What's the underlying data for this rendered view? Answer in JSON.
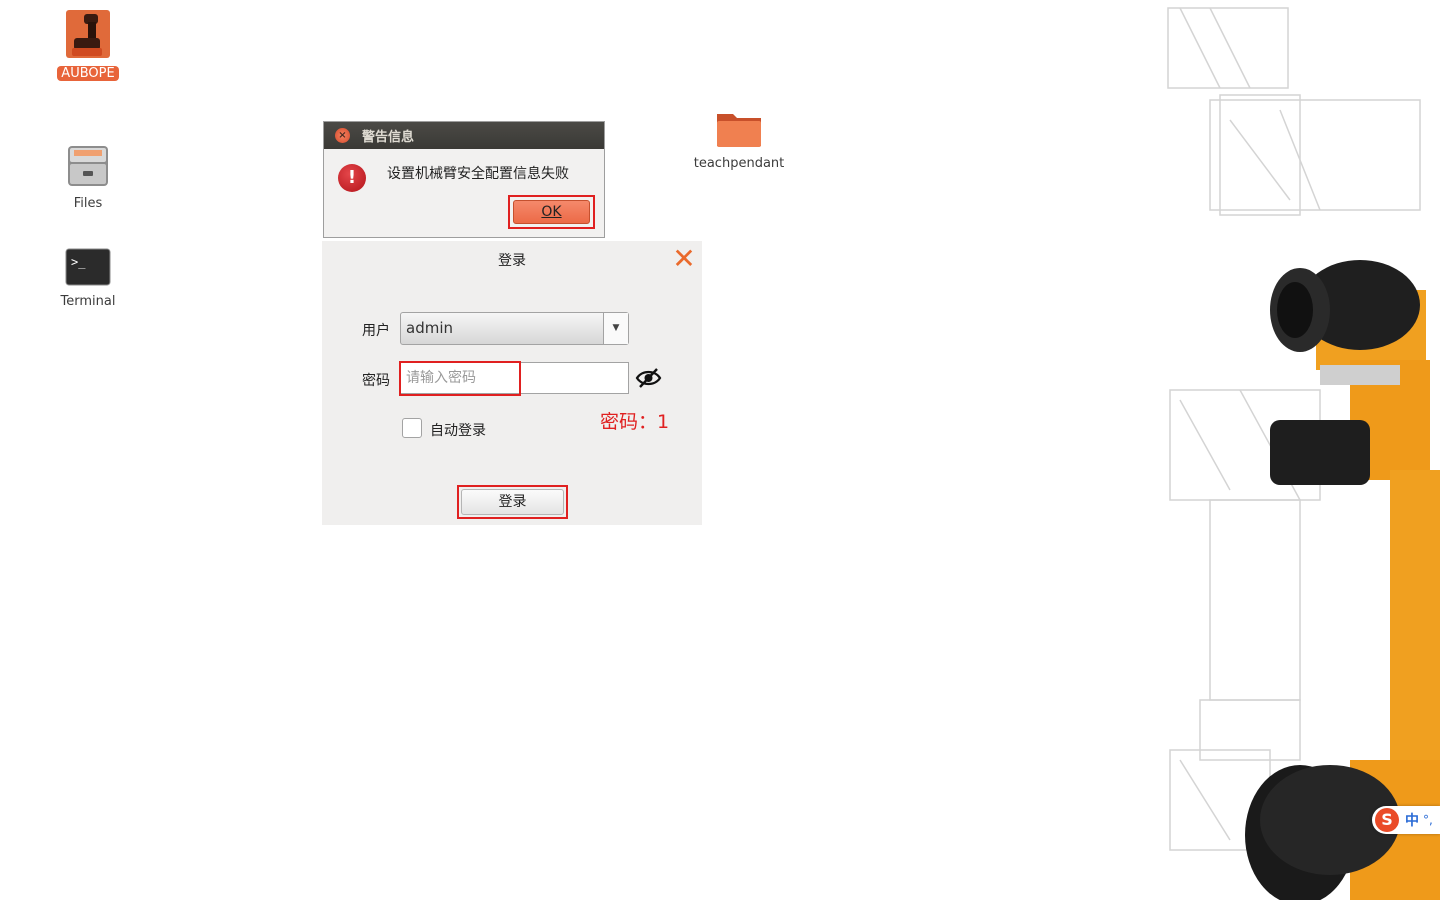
{
  "desktop": {
    "icons": [
      {
        "label": "AUBOPE",
        "icon": "aubope-robot-icon"
      },
      {
        "label": "Files",
        "icon": "file-cabinet-icon"
      },
      {
        "label": "Terminal",
        "icon": "terminal-icon"
      },
      {
        "label": "teachpendant",
        "icon": "folder-icon"
      }
    ]
  },
  "warning_dialog": {
    "title": "警告信息",
    "message": "设置机械臂安全配置信息失败",
    "ok_label": "OK"
  },
  "login_dialog": {
    "title": "登录",
    "user_label": "用户",
    "user_value": "admin",
    "password_label": "密码",
    "password_placeholder": "请输入密码",
    "auto_login_label": "自动登录",
    "password_hint": "密码：1",
    "login_button": "登录"
  },
  "ime": {
    "logo": "S",
    "mode": "中",
    "punct": "°,"
  },
  "colors": {
    "accent": "#e8643a",
    "annotation_red": "#e02020",
    "robot_orange": "#f0a020"
  }
}
